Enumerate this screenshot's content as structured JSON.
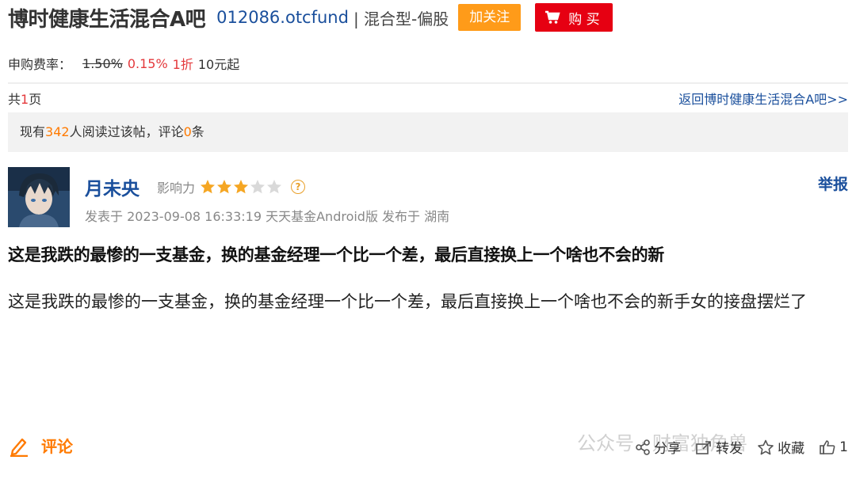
{
  "header": {
    "title": "博时健康生活混合A吧",
    "fund_code": "012086.otcfund",
    "separator": "|",
    "fund_type": "混合型-偏股",
    "follow_label": "加关注",
    "buy_label": "购 买"
  },
  "fee": {
    "label": "申购费率：",
    "old_rate": "1.50%",
    "new_rate": "0.15%",
    "discount": "1折",
    "minimum": "10元起"
  },
  "pager": {
    "prefix": "共",
    "count": "1",
    "suffix": "页",
    "back_link": "返回博时健康生活混合A吧>>"
  },
  "stats": {
    "prefix": "现有",
    "readers": "342",
    "mid": "人阅读过该帖，评论",
    "comments": "0",
    "suffix": "条"
  },
  "post": {
    "author": "月未央",
    "influence_label": "影响力",
    "rating": 3,
    "rating_max": 5,
    "report_label": "举报",
    "meta": "发表于 2023-09-08 16:33:19 天天基金Android版 发布于 湖南",
    "title": "这是我跌的最惨的一支基金，换的基金经理一个比一个差，最后直接换上一个啥也不会的新",
    "body": "这是我跌的最惨的一支基金，换的基金经理一个比一个差，最后直接换上一个啥也不会的新手女的接盘摆烂了"
  },
  "footer": {
    "comment_label": "评论",
    "share_label": "分享",
    "forward_label": "转发",
    "favorite_label": "收藏",
    "like_count": "1",
    "watermark": "公众号 · 财富独角兽"
  },
  "colors": {
    "link_blue": "#1a4f9c",
    "orange": "#ff9b19",
    "buy_red": "#e60012",
    "highlight_red": "#e4393c",
    "star_gold": "#f5a623",
    "star_empty": "#d9d9d9"
  }
}
